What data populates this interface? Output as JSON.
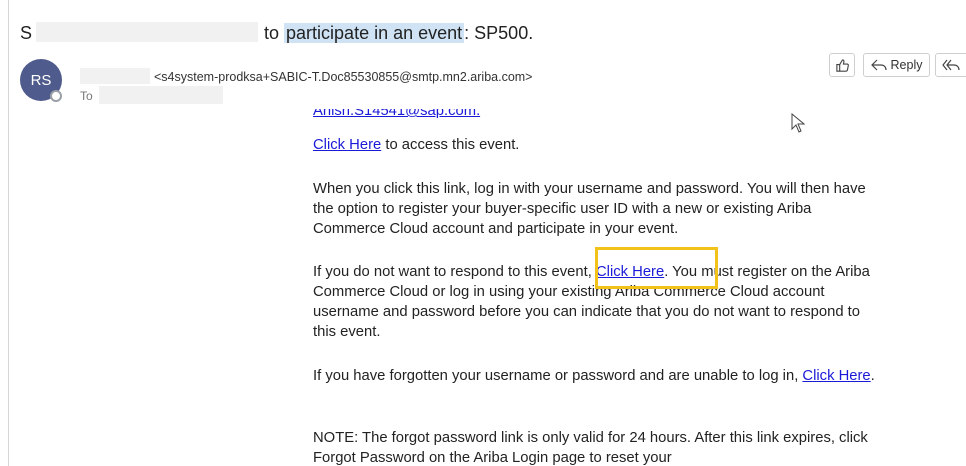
{
  "subject": {
    "prefix": "S",
    "text": "to ",
    "highlight": "participate in an event",
    "suffix": ": SP500."
  },
  "sender": {
    "initials": "RS",
    "address": "<s4system-prodksa+SABIC-T.Doc85530855@smtp.mn2.ariba.com>",
    "to_label": "To"
  },
  "actions": {
    "like_icon": "thumbs-up-icon",
    "reply_label": "Reply",
    "reply_icon": "reply-arrow-icon",
    "reply_all_icon": "reply-all-icon"
  },
  "body": {
    "cut_email": "Anish.S14541@sap.com.",
    "p1_link": "Click Here",
    "p1_text": " to access this event.",
    "p2": "When you click this link, log in with your username and password. You will then have the option to register your buyer-specific user ID with a new or existing Ariba Commerce Cloud account and participate in your event.",
    "p3_before": "If you do not want to respond to this event, ",
    "p3_link": "Click Here",
    "p3_after": ". You must register on the Ariba Commerce Cloud or log in using your existing Ariba Commerce Cloud account username and password before you can indicate that you do not want to respond to this event.",
    "p4_text": "If you have forgotten your username or password and are unable to log in, ",
    "p4_link": "Click Here",
    "p4_end": ".",
    "p5": "NOTE: The forgot password link is only valid for 24 hours. After this link expires, click Forgot Password on the Ariba Login page to reset your"
  },
  "colors": {
    "link": "#1a1ad8",
    "avatar": "#4f5b8c",
    "highlight": "#cfe3f5",
    "focus_box": "#f3c21a"
  }
}
